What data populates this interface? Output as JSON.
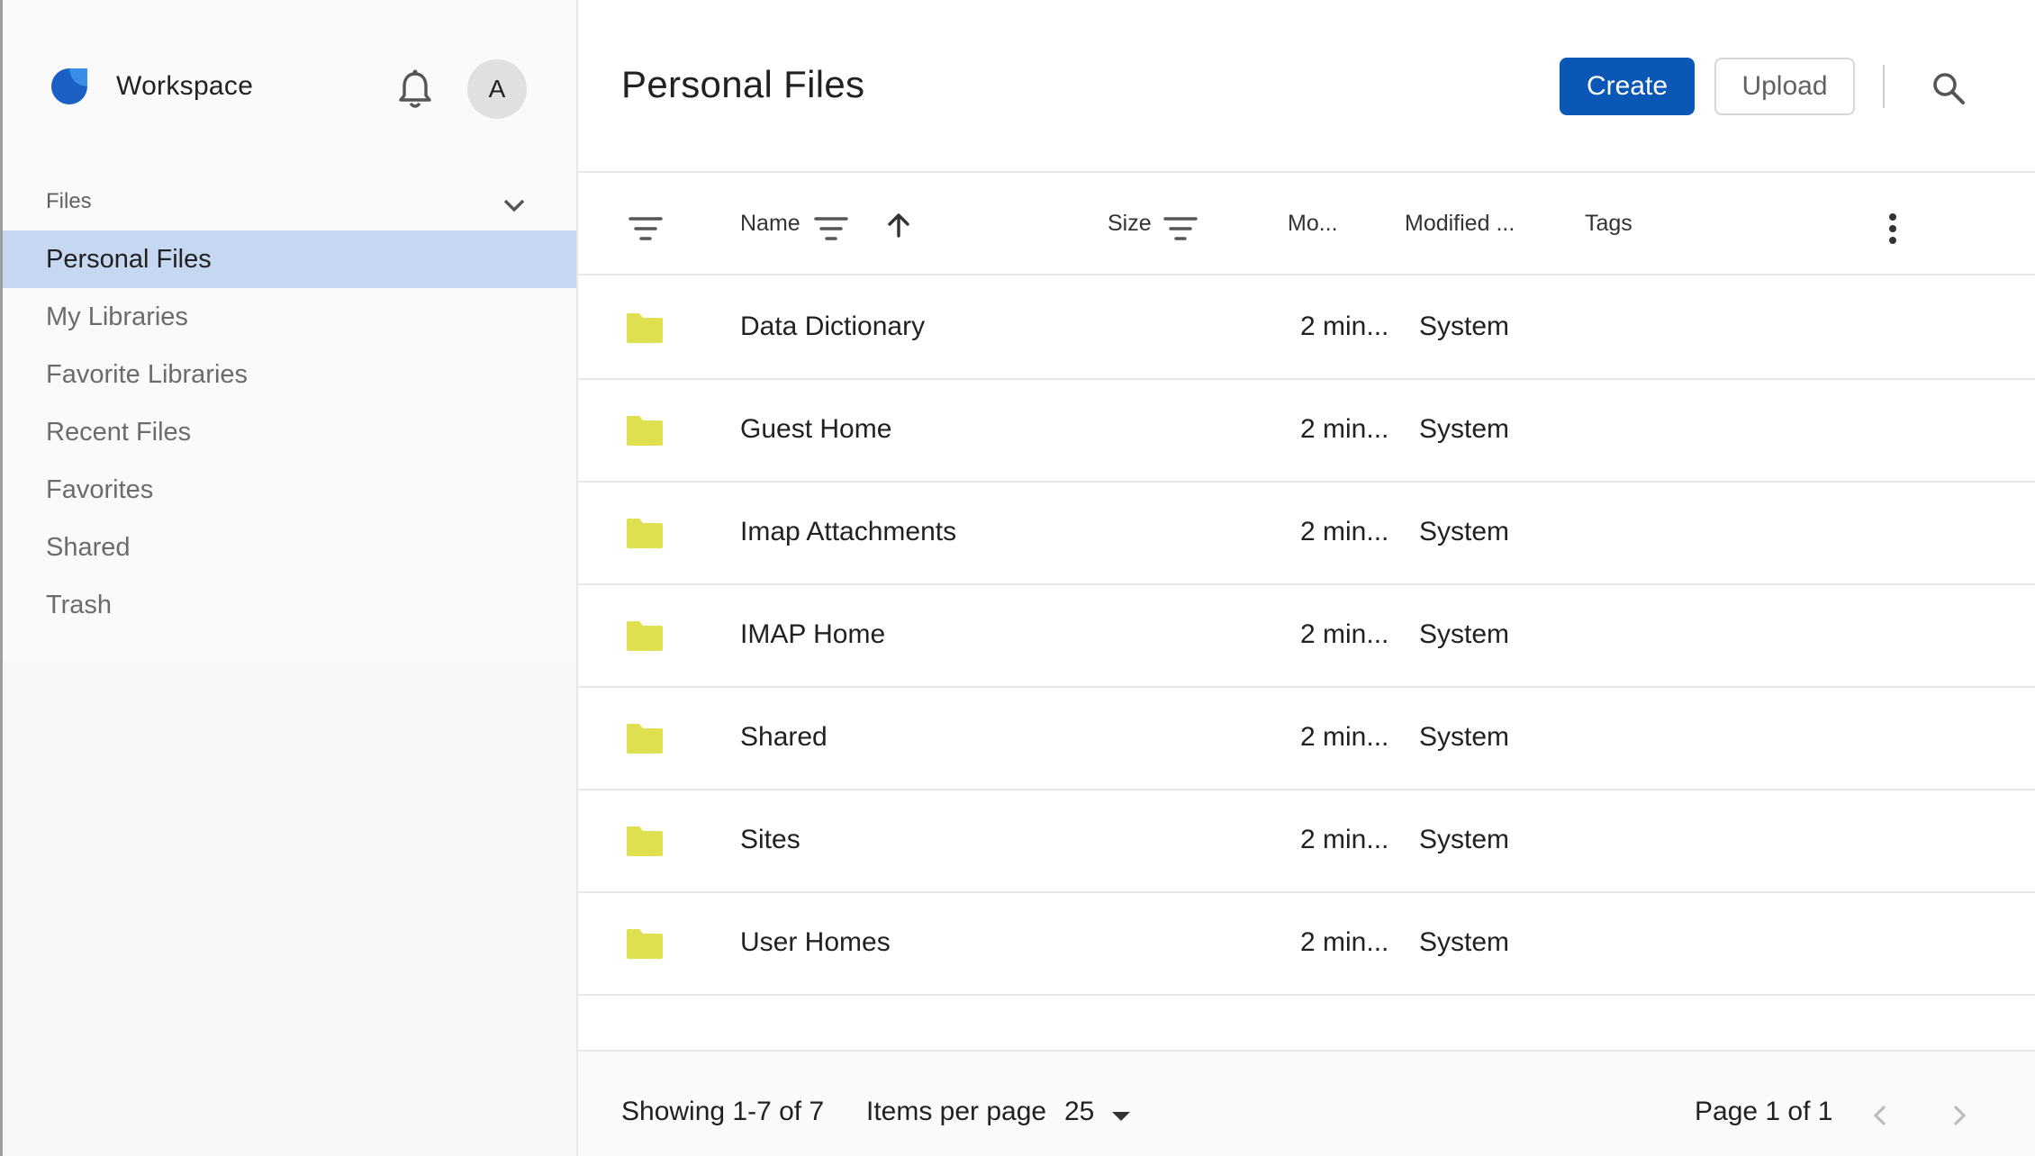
{
  "sidebar": {
    "app_title": "Workspace",
    "avatar_initial": "A",
    "section_label": "Files",
    "items": [
      {
        "label": "Personal Files",
        "active": true
      },
      {
        "label": "My Libraries"
      },
      {
        "label": "Favorite Libraries"
      },
      {
        "label": "Recent Files"
      },
      {
        "label": "Favorites"
      },
      {
        "label": "Shared"
      },
      {
        "label": "Trash"
      }
    ]
  },
  "header": {
    "title": "Personal Files",
    "create_label": "Create",
    "upload_label": "Upload"
  },
  "table": {
    "columns": {
      "name": "Name",
      "size": "Size",
      "modified": "Mo...",
      "modified_by": "Modified ...",
      "tags": "Tags"
    },
    "rows": [
      {
        "name": "Data Dictionary",
        "modified": "2 min...",
        "modified_by": "System"
      },
      {
        "name": "Guest Home",
        "modified": "2 min...",
        "modified_by": "System"
      },
      {
        "name": "Imap Attachments",
        "modified": "2 min...",
        "modified_by": "System"
      },
      {
        "name": "IMAP Home",
        "modified": "2 min...",
        "modified_by": "System"
      },
      {
        "name": "Shared",
        "modified": "2 min...",
        "modified_by": "System"
      },
      {
        "name": "Sites",
        "modified": "2 min...",
        "modified_by": "System"
      },
      {
        "name": "User Homes",
        "modified": "2 min...",
        "modified_by": "System"
      }
    ]
  },
  "footer": {
    "showing": "Showing 1-7 of 7",
    "items_per_page_label": "Items per page",
    "items_per_page_value": "25",
    "page_label": "Page 1 of 1"
  },
  "colors": {
    "accent": "#0b57b6",
    "active_nav": "#c6d8f1",
    "folder": "#dfe04f",
    "logo_dark": "#1a5fc2",
    "logo_light": "#3a8ee8"
  },
  "icons": [
    "logo-icon",
    "bell-icon",
    "chevron-down-icon",
    "search-icon",
    "filter-icon",
    "sort-up-arrow-icon",
    "more-vert-icon",
    "folder-icon",
    "caret-down-icon",
    "chevron-left-icon",
    "chevron-right-icon"
  ]
}
